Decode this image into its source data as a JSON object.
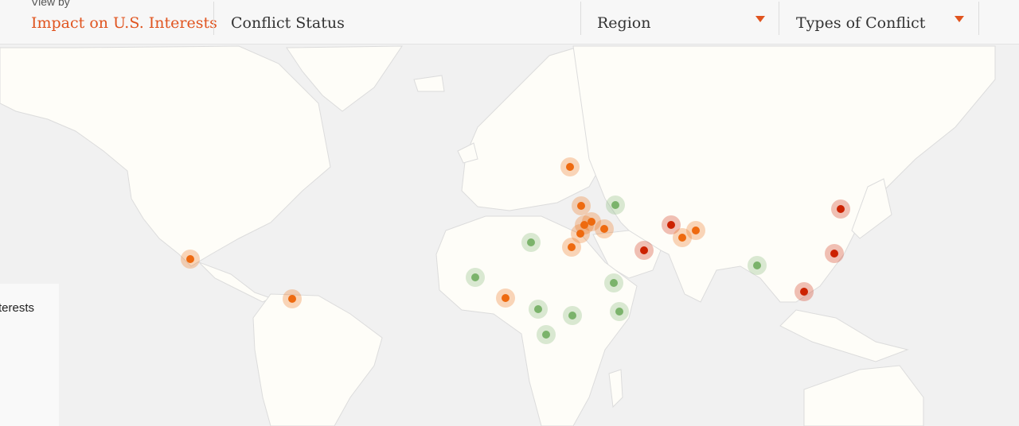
{
  "header": {
    "view_by_label": "View by",
    "tabs": [
      {
        "label": "Impact on U.S. Interests",
        "active": true
      },
      {
        "label": "Conflict Status",
        "active": false
      }
    ],
    "dropdowns": [
      {
        "label": "Region"
      },
      {
        "label": "Types of Conflict"
      }
    ]
  },
  "legend": {
    "label": "terests"
  },
  "colors": {
    "ocean": "#f1f1f1",
    "land": "#fefdf8",
    "border": "#dcdcdc",
    "accent": "#e0541f",
    "critical": "#cc2200",
    "significant": "#ee6a10",
    "limited": "#7bb36b"
  },
  "markers": [
    {
      "name": "mexico",
      "level": "significant"
    },
    {
      "name": "venezuela",
      "level": "significant"
    },
    {
      "name": "ukraine",
      "level": "significant"
    },
    {
      "name": "turkey",
      "level": "significant"
    },
    {
      "name": "caucasus",
      "level": "limited"
    },
    {
      "name": "syria",
      "level": "significant"
    },
    {
      "name": "iraq",
      "level": "significant"
    },
    {
      "name": "lebanon",
      "level": "significant"
    },
    {
      "name": "israel",
      "level": "significant"
    },
    {
      "name": "egypt",
      "level": "significant"
    },
    {
      "name": "libya",
      "level": "limited"
    },
    {
      "name": "yemen",
      "level": "critical"
    },
    {
      "name": "afghanistan",
      "level": "critical"
    },
    {
      "name": "pakistan",
      "level": "significant"
    },
    {
      "name": "india-kashmir",
      "level": "significant"
    },
    {
      "name": "myanmar",
      "level": "limited"
    },
    {
      "name": "korea",
      "level": "critical"
    },
    {
      "name": "taiwan",
      "level": "critical"
    },
    {
      "name": "south-china-sea",
      "level": "critical"
    },
    {
      "name": "mali",
      "level": "limited"
    },
    {
      "name": "nigeria",
      "level": "significant"
    },
    {
      "name": "car",
      "level": "limited"
    },
    {
      "name": "south-sudan",
      "level": "limited"
    },
    {
      "name": "ethiopia",
      "level": "limited"
    },
    {
      "name": "somalia",
      "level": "limited"
    },
    {
      "name": "drc",
      "level": "limited"
    }
  ]
}
